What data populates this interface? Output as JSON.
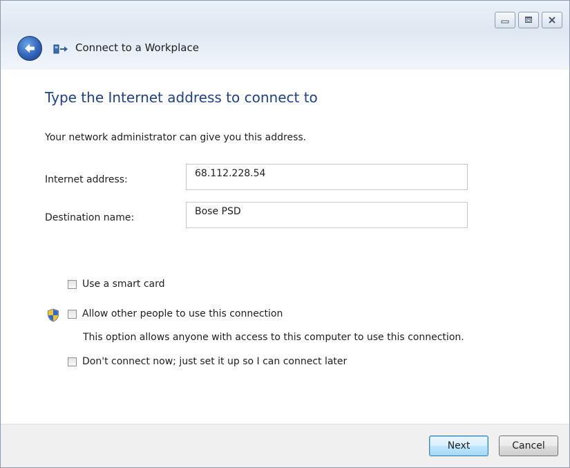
{
  "window": {
    "title": "Connect to a Workplace",
    "caption_icons": [
      "minimize-icon",
      "maximize-icon",
      "close-icon"
    ]
  },
  "page": {
    "heading": "Type the Internet address to connect to",
    "intro": "Your network administrator can give you this address."
  },
  "form": {
    "internet_address": {
      "label": "Internet address:",
      "value": "68.112.228.54"
    },
    "destination_name": {
      "label": "Destination name:",
      "value": "Bose PSD"
    }
  },
  "options": {
    "smart_card": {
      "label": "Use a smart card",
      "checked": false
    },
    "allow_others": {
      "label": "Allow other people to use this connection",
      "checked": false,
      "note": "This option allows anyone with access to this computer to use this connection."
    },
    "connect_later": {
      "label": "Don't connect now; just set it up so I can connect later",
      "checked": false
    }
  },
  "footer": {
    "next_label": "Next",
    "cancel_label": "Cancel"
  },
  "colors": {
    "heading": "#1c3f94",
    "back_button": "#2f63b8",
    "footer_bg": "#f0f0f0"
  }
}
